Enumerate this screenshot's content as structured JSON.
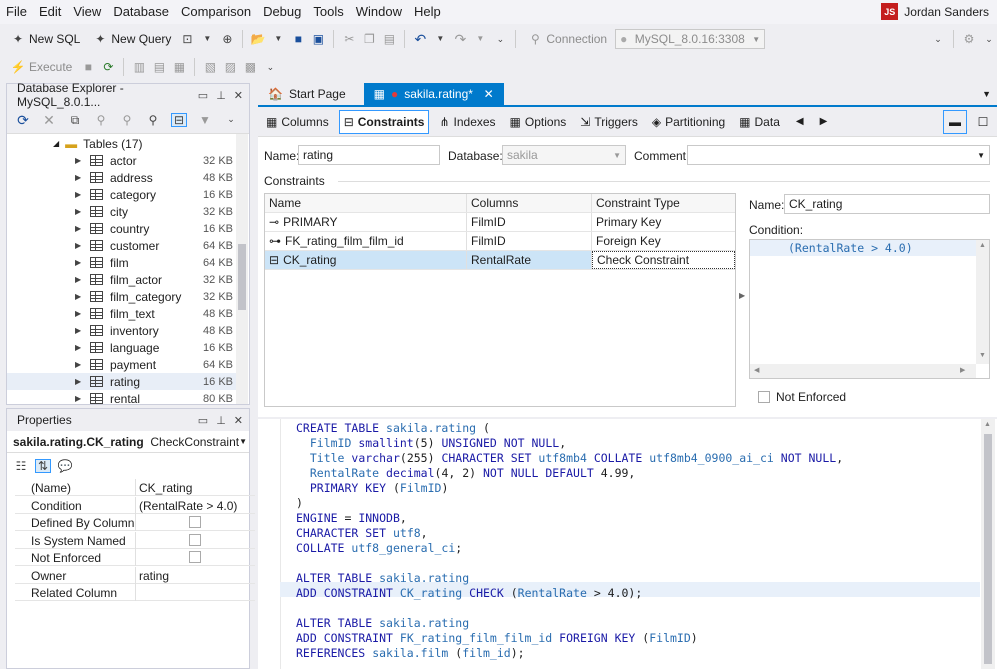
{
  "menu": [
    "File",
    "Edit",
    "View",
    "Database",
    "Comparison",
    "Debug",
    "Tools",
    "Window",
    "Help"
  ],
  "user": {
    "initials": "JS",
    "name": "Jordan Sanders"
  },
  "toolbar1": {
    "new_sql": "New SQL",
    "new_query": "New Query",
    "connection_label": "Connection",
    "connection_value": "MySQL_8.0.16:3308"
  },
  "toolbar2": {
    "execute": "Execute"
  },
  "db_explorer": {
    "title": "Database Explorer - MySQL_8.0.1...",
    "tables_node": "Tables (17)",
    "tables": [
      {
        "name": "actor",
        "size": "32 KB"
      },
      {
        "name": "address",
        "size": "48 KB"
      },
      {
        "name": "category",
        "size": "16 KB"
      },
      {
        "name": "city",
        "size": "32 KB"
      },
      {
        "name": "country",
        "size": "16 KB"
      },
      {
        "name": "customer",
        "size": "64 KB"
      },
      {
        "name": "film",
        "size": "64 KB"
      },
      {
        "name": "film_actor",
        "size": "32 KB"
      },
      {
        "name": "film_category",
        "size": "32 KB"
      },
      {
        "name": "film_text",
        "size": "48 KB"
      },
      {
        "name": "inventory",
        "size": "48 KB"
      },
      {
        "name": "language",
        "size": "16 KB"
      },
      {
        "name": "payment",
        "size": "64 KB"
      },
      {
        "name": "rating",
        "size": "16 KB"
      },
      {
        "name": "rental",
        "size": "80 KB"
      }
    ]
  },
  "properties": {
    "title": "Properties",
    "object": "sakila.rating.CK_rating",
    "object_type": "CheckConstraint",
    "rows": [
      {
        "name": "(Name)",
        "value": "CK_rating"
      },
      {
        "name": "Condition",
        "value": "(RentalRate > 4.0)"
      },
      {
        "name": "Defined By Column",
        "value": ""
      },
      {
        "name": "Is System Named",
        "value": ""
      },
      {
        "name": "Not Enforced",
        "value": ""
      },
      {
        "name": "Owner",
        "value": "rating"
      },
      {
        "name": "Related Column",
        "value": ""
      }
    ]
  },
  "doc_tabs": {
    "start": "Start Page",
    "active": "sakila.rating*"
  },
  "editor_tabs": [
    "Columns",
    "Constraints",
    "Indexes",
    "Options",
    "Triggers",
    "Partitioning",
    "Data"
  ],
  "table_form": {
    "name_label": "Name:",
    "name_value": "rating",
    "db_label": "Database:",
    "db_value": "sakila",
    "comment_label": "Comment:",
    "comment_value": ""
  },
  "constraints": {
    "section": "Constraints",
    "headers": [
      "Name",
      "Columns",
      "Constraint Type"
    ],
    "rows": [
      {
        "name": "PRIMARY",
        "columns": "FilmID",
        "type": "Primary Key"
      },
      {
        "name": "FK_rating_film_film_id",
        "columns": "FilmID",
        "type": "Foreign Key"
      },
      {
        "name": "CK_rating",
        "columns": "RentalRate",
        "type": "Check Constraint"
      }
    ]
  },
  "constraint_detail": {
    "name_label": "Name:",
    "name_value": "CK_rating",
    "condition_label": "Condition:",
    "condition_value": "(RentalRate > 4.0)",
    "not_enforced": "Not Enforced"
  },
  "sql": [
    "CREATE TABLE sakila.rating (",
    "  FilmID smallint(5) UNSIGNED NOT NULL,",
    "  Title varchar(255) CHARACTER SET utf8mb4 COLLATE utf8mb4_0900_ai_ci NOT NULL,",
    "  RentalRate decimal(4, 2) NOT NULL DEFAULT 4.99,",
    "  PRIMARY KEY (FilmID)",
    ")",
    "ENGINE = INNODB,",
    "CHARACTER SET utf8,",
    "COLLATE utf8_general_ci;",
    "",
    "ALTER TABLE sakila.rating",
    "ADD CONSTRAINT CK_rating CHECK (RentalRate > 4.0);",
    "",
    "ALTER TABLE sakila.rating",
    "ADD CONSTRAINT FK_rating_film_film_id FOREIGN KEY (FilmID)",
    "REFERENCES sakila.film (film_id);"
  ],
  "colors": {
    "accent": "#007acc",
    "tab_active": "#007acc",
    "selected_row": "#cce4f7",
    "keyword": "#1a1aa6"
  }
}
